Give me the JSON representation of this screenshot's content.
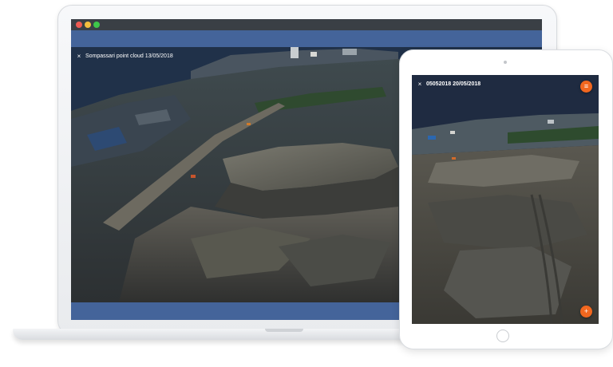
{
  "laptop": {
    "viewer_title": "Sompassari point cloud 13/05/2018",
    "close_symbol": "×",
    "window_dots": [
      "red",
      "yellow",
      "green"
    ],
    "colors": {
      "frame_blue": "#44649a",
      "sky": "#203149"
    }
  },
  "tablet": {
    "viewer_title": "05052018 20/05/2018",
    "close_symbol": "×",
    "menu_symbol": "≡",
    "add_symbol": "+",
    "colors": {
      "accent": "#f2671f",
      "sky": "#1f2b41"
    }
  }
}
